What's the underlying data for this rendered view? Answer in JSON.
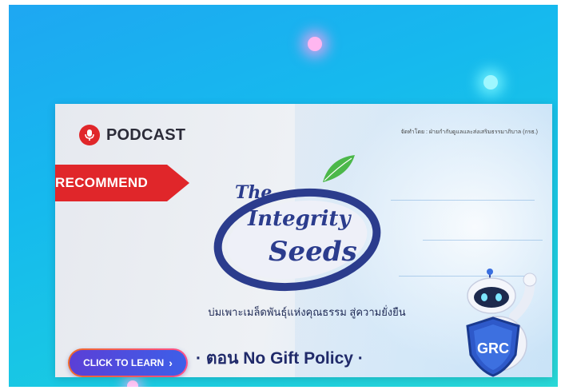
{
  "badge": {
    "podcast_label": "PODCAST",
    "icon": "microphone-icon"
  },
  "organizer_note": "จัดทำโดย : ฝ่ายกำกับดูแลและส่งเสริมธรรมาภิบาล (กรธ.)",
  "ribbon": {
    "label": "RECOMMEND"
  },
  "logo": {
    "line1": "The",
    "line2": "Integrity",
    "line3": "Seeds"
  },
  "tagline": "บ่มเพาะเมล็ดพันธุ์แห่งคุณธรรม สู่ความยั่งยืน",
  "cta": {
    "label": "CLICK TO LEARN",
    "icon": "chevron-right-icon"
  },
  "episode_title": "· ตอน No Gift Policy ·",
  "mascot": {
    "shield_text": "GRC"
  },
  "colors": {
    "background": "#16b9ee",
    "ribbon": "#e0262a",
    "cta_gradient_start": "#f06a2a",
    "cta_fill": "#3d5fe8",
    "title_navy": "#202a6a"
  }
}
